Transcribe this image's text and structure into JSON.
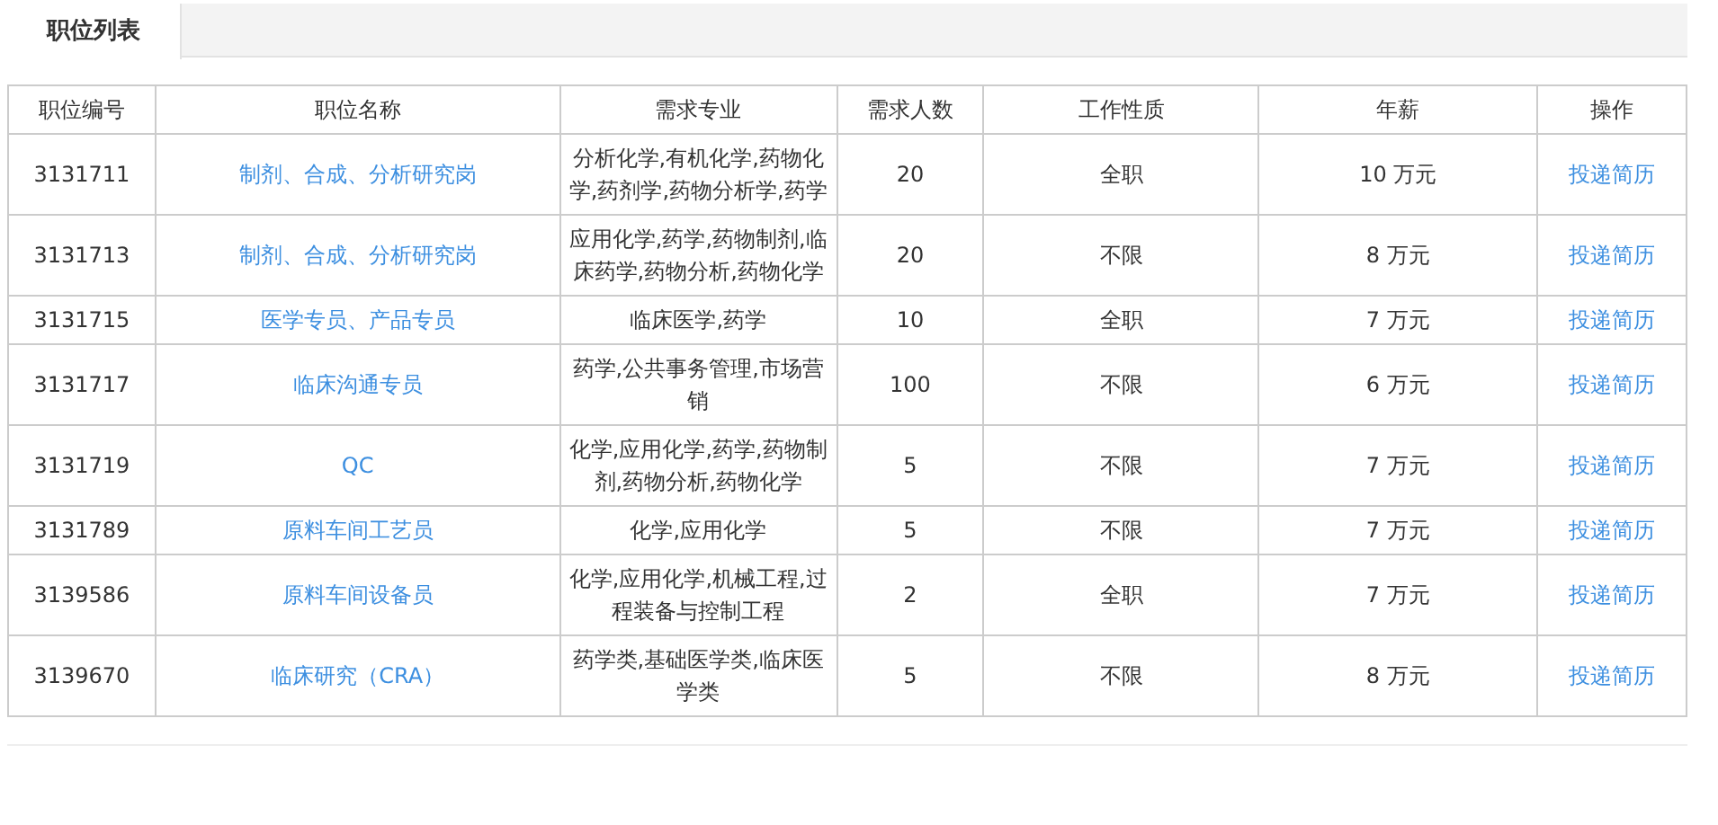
{
  "tabs": [
    {
      "label": "职位列表",
      "selected": true
    }
  ],
  "table": {
    "columns": [
      "职位编号",
      "职位名称",
      "需求专业",
      "需求人数",
      "工作性质",
      "年薪",
      "操作"
    ],
    "rows": [
      {
        "id": "3131711",
        "title": "制剂、合成、分析研究岗",
        "majors": "分析化学,有机化学,药物化学,药剂学,药物分析学,药学",
        "count": "20",
        "type": "全职",
        "salary": "10 万元",
        "action": "投递简历"
      },
      {
        "id": "3131713",
        "title": "制剂、合成、分析研究岗",
        "majors": "应用化学,药学,药物制剂,临床药学,药物分析,药物化学",
        "count": "20",
        "type": "不限",
        "salary": "8 万元",
        "action": "投递简历"
      },
      {
        "id": "3131715",
        "title": "医学专员、产品专员",
        "majors": "临床医学,药学",
        "count": "10",
        "type": "全职",
        "salary": "7 万元",
        "action": "投递简历"
      },
      {
        "id": "3131717",
        "title": "临床沟通专员",
        "majors": "药学,公共事务管理,市场营销",
        "count": "100",
        "type": "不限",
        "salary": "6 万元",
        "action": "投递简历"
      },
      {
        "id": "3131719",
        "title": "QC",
        "majors": "化学,应用化学,药学,药物制剂,药物分析,药物化学",
        "count": "5",
        "type": "不限",
        "salary": "7 万元",
        "action": "投递简历"
      },
      {
        "id": "3131789",
        "title": "原料车间工艺员",
        "majors": "化学,应用化学",
        "count": "5",
        "type": "不限",
        "salary": "7 万元",
        "action": "投递简历"
      },
      {
        "id": "3139586",
        "title": "原料车间设备员",
        "majors": "化学,应用化学,机械工程,过程装备与控制工程",
        "count": "2",
        "type": "全职",
        "salary": "7 万元",
        "action": "投递简历"
      },
      {
        "id": "3139670",
        "title": "临床研究（CRA）",
        "majors": "药学类,基础医学类,临床医学类",
        "count": "5",
        "type": "不限",
        "salary": "8 万元",
        "action": "投递简历"
      }
    ]
  }
}
